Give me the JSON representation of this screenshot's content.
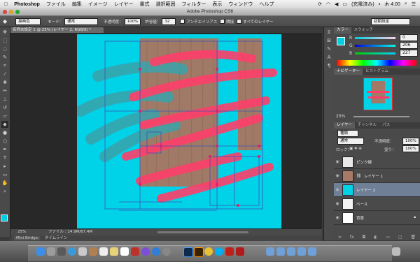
{
  "menubar": {
    "app_name": "Photoshop",
    "items": [
      "ファイル",
      "編集",
      "イメージ",
      "レイヤー",
      "書式",
      "選択範囲",
      "フィルター",
      "表示",
      "ウィンドウ",
      "ヘルプ"
    ],
    "battery_text": "(充電済み)",
    "clock": "木 4:00"
  },
  "window": {
    "title": "Adobe Photoshop CS6"
  },
  "options": {
    "tool_preset": "描画色",
    "mode_label": "モード：",
    "mode_value": "通常",
    "opacity_label": "不透明度：",
    "opacity_value": "100%",
    "tolerance_label": "許容値：",
    "tolerance_value": "32",
    "antialias_label": "アンチエイリアス",
    "contiguous_label": "隣接",
    "all_layers_label": "すべてのレイヤー",
    "workspace": "初期設定"
  },
  "document": {
    "tab_title": "名称未設定 1 @ 25% (レイヤー 2, RGB/8) *",
    "zoom": "25%",
    "file_info": "ファイル : 24.9M/67.4M"
  },
  "bottom_tabs": [
    "Mini Bridge",
    "タイムライン"
  ],
  "color_panel": {
    "tabs": [
      "カラー",
      "スウォッチ"
    ],
    "r_label": "R",
    "g_label": "G",
    "b_label": "B",
    "r_value": "0",
    "g_value": "206",
    "b_value": "227",
    "fg_color": "#00cee3"
  },
  "navigator_panel": {
    "tabs": [
      "ナビゲーター",
      "ヒストグラム"
    ],
    "zoom": "25%"
  },
  "layers_panel": {
    "tabs": [
      "レイヤー",
      "チャンネル",
      "パス"
    ],
    "filter_label": "種類",
    "blend_mode": "通常",
    "opacity_label": "不透明度：",
    "opacity_value": "100%",
    "lock_label": "ロック：",
    "fill_label": "塗り：",
    "fill_value": "100%",
    "layers": [
      {
        "name": "ピンク線",
        "thumb": "#e8e8e8",
        "selected": false
      },
      {
        "name": "レイヤー 1",
        "thumb": "#a87a66",
        "selected": false
      },
      {
        "name": "レイヤー 2",
        "thumb": "#00d2e8",
        "selected": true
      },
      {
        "name": "ベース",
        "thumb": "#f2f2f2",
        "selected": false
      },
      {
        "name": "背景",
        "thumb": "#ffffff",
        "selected": false
      }
    ]
  },
  "accent_colors": {
    "canvas_cyan": "#00d2e8",
    "stroke_red": "#ff3f6a",
    "wood": "#9a7a66"
  }
}
